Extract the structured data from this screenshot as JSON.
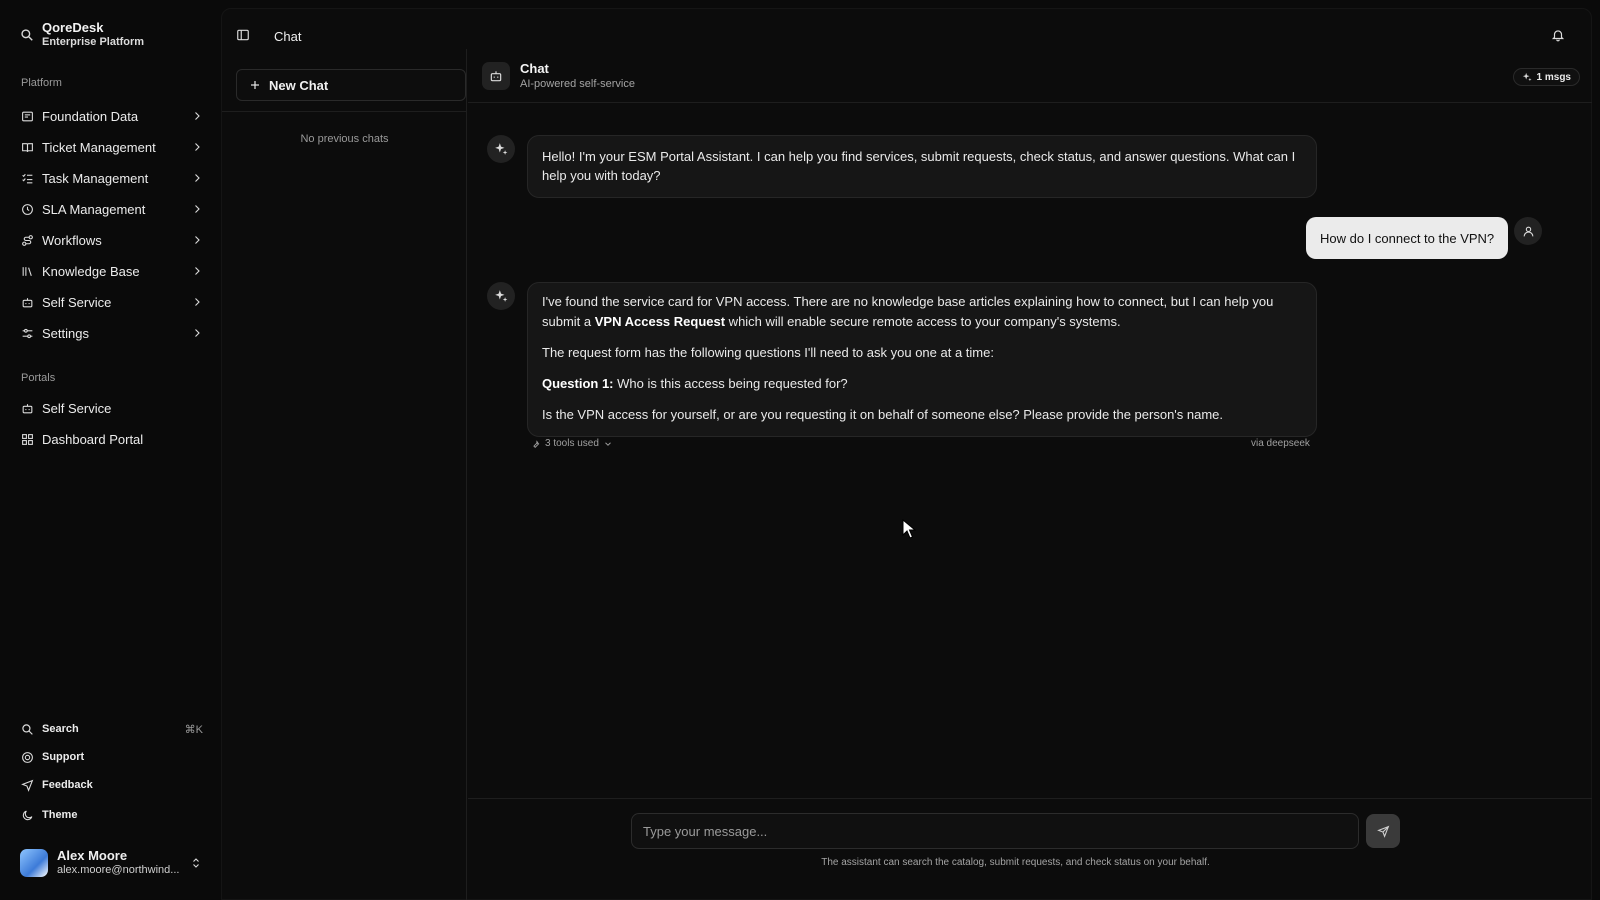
{
  "brand": {
    "name": "QoreDesk",
    "subtitle": "Enterprise Platform"
  },
  "sidebar": {
    "platform_label": "Platform",
    "platform_items": [
      {
        "label": "Foundation Data",
        "icon": "database-icon"
      },
      {
        "label": "Ticket Management",
        "icon": "book-icon"
      },
      {
        "label": "Task Management",
        "icon": "list-checks-icon"
      },
      {
        "label": "SLA Management",
        "icon": "clock-icon"
      },
      {
        "label": "Workflows",
        "icon": "route-icon"
      },
      {
        "label": "Knowledge Base",
        "icon": "library-icon"
      },
      {
        "label": "Self Service",
        "icon": "bot-icon"
      },
      {
        "label": "Settings",
        "icon": "sliders-icon"
      }
    ],
    "portals_label": "Portals",
    "portal_items": [
      {
        "label": "Self Service",
        "icon": "bot-icon"
      },
      {
        "label": "Dashboard Portal",
        "icon": "grid-icon"
      }
    ],
    "bottom": {
      "search": "Search",
      "search_shortcut": "⌘K",
      "support": "Support",
      "feedback": "Feedback",
      "theme": "Theme"
    },
    "user": {
      "name": "Alex Moore",
      "email": "alex.moore@northwind..."
    }
  },
  "topbar": {
    "title": "Chat"
  },
  "chats": {
    "new_chat_label": "New Chat",
    "empty_text": "No previous chats"
  },
  "conversation": {
    "title": "Chat",
    "subtitle": "AI-powered self-service",
    "message_count": "1 msgs",
    "messages": {
      "greeting": "Hello! I'm your ESM Portal Assistant. I can help you find services, submit requests, check status, and answer questions. What can I help you with today?",
      "user_question": "How do I connect to the VPN?",
      "reply_p1_before": "I've found the service card for VPN access. There are no knowledge base articles explaining how to connect, but I can help you submit a ",
      "reply_p1_bold": "VPN Access Request",
      "reply_p1_after": " which will enable secure remote access to your company's systems.",
      "reply_p2": "The request form has the following questions I'll need to ask you one at a time:",
      "reply_p3_bold": "Question 1:",
      "reply_p3_after": " Who is this access being requested for?",
      "reply_p4": "Is the VPN access for yourself, or are you requesting it on behalf of someone else? Please provide the person's name.",
      "tools_used": "3 tools used",
      "model": "via deepseek"
    },
    "composer": {
      "placeholder": "Type your message...",
      "hint": "The assistant can search the catalog, submit requests, and check status on your behalf."
    }
  },
  "colors": {
    "background": "#0a0a0a",
    "panel": "#0c0c0c",
    "bubble": "#161616",
    "user_bubble": "#ebebeb"
  }
}
